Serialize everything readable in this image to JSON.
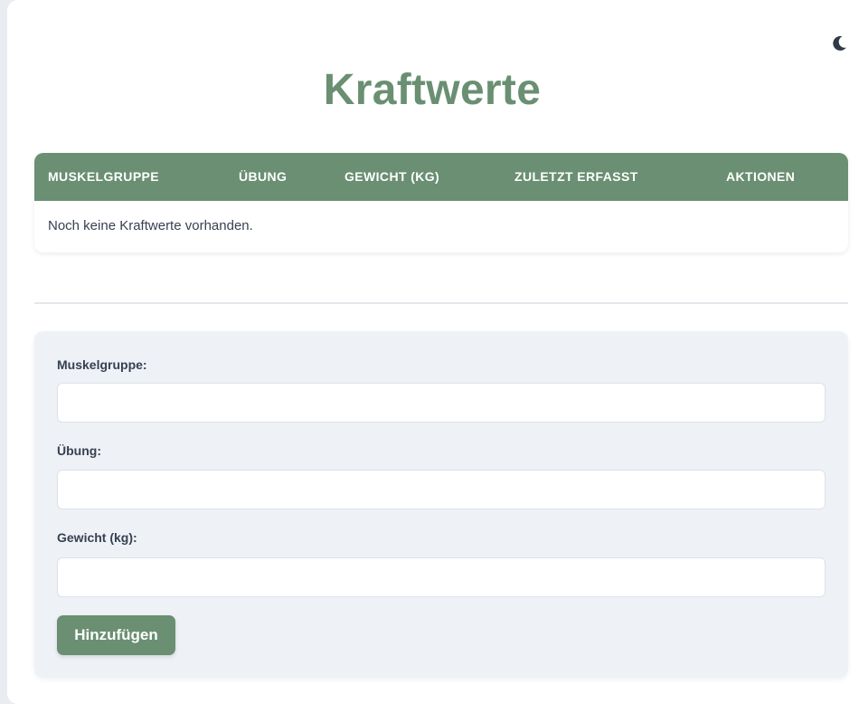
{
  "header": {
    "title": "Kraftwerte",
    "theme_toggle_icon": "moon-icon"
  },
  "table": {
    "columns": [
      "Muskelgruppe",
      "Übung",
      "Gewicht (kg)",
      "Zuletzt erfasst",
      "Aktionen"
    ],
    "empty_message": "Noch keine Kraftwerte vorhanden."
  },
  "form": {
    "muscle_group_label": "Muskelgruppe:",
    "muscle_group_value": "",
    "exercise_label": "Übung:",
    "exercise_value": "",
    "weight_label": "Gewicht (kg):",
    "weight_value": "",
    "submit_label": "Hinzufügen"
  },
  "colors": {
    "accent": "#6a8f72",
    "form_background": "#eef1f6",
    "text": "#374151"
  }
}
